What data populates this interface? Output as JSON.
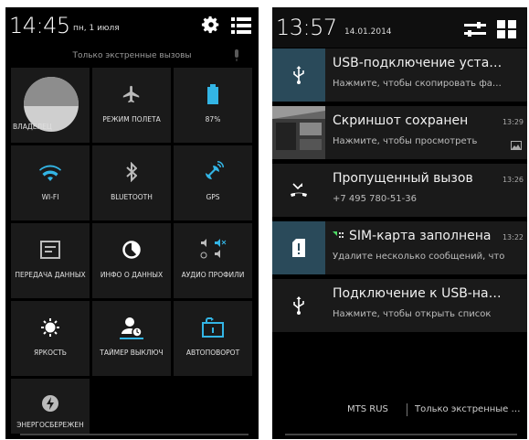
{
  "quick_settings": {
    "time": "14:45",
    "date": "пн, 1 июля",
    "emergency_text": "Только экстренные вызовы",
    "tiles": [
      {
        "label": "ВЛАДЕЛЕЦ",
        "icon": "avatar"
      },
      {
        "label": "РЕЖИМ ПОЛЕТА",
        "icon": "airplane-icon"
      },
      {
        "label": "87%",
        "icon": "battery-icon"
      },
      {
        "label": "WI-FI",
        "icon": "wifi-icon"
      },
      {
        "label": "BLUETOOTH",
        "icon": "bluetooth-icon"
      },
      {
        "label": "GPS",
        "icon": "gps-icon"
      },
      {
        "label": "ПЕРЕДАЧА ДАННЫХ",
        "icon": "data-transfer-icon"
      },
      {
        "label": "ИНФО О ДАННЫХ",
        "icon": "data-usage-icon"
      },
      {
        "label": "АУДИО ПРОФИЛИ",
        "icon": "audio-profiles-icon"
      },
      {
        "label": "ЯРКОСТЬ",
        "icon": "brightness-icon"
      },
      {
        "label": "ТАЙМЕР ВЫКЛЮЧ",
        "icon": "sleep-timer-icon"
      },
      {
        "label": "АВТОПОВОРОТ",
        "icon": "auto-rotate-icon"
      },
      {
        "label": "ЭНЕРГОСБЕРЕЖЕН",
        "icon": "power-saving-icon"
      }
    ]
  },
  "notifications_panel": {
    "time": "13:57",
    "date": "14.01.2014",
    "notifications": [
      {
        "title": "USB-подключение установлено",
        "text": "Нажмите, чтобы скопировать файлы",
        "time": "",
        "icon": "usb-icon"
      },
      {
        "title": "Скриншот сохранен",
        "text": "Нажмите, чтобы просмотреть",
        "time": "13:29",
        "icon": "screenshot-thumbnail"
      },
      {
        "title": "Пропущенный вызов",
        "text": "+7 495 780-51-36",
        "time": "13:26",
        "icon": "missed-call-icon"
      },
      {
        "title": "SIM-карта заполнена",
        "text": "Удалите несколько сообщений, что",
        "time": "13:22",
        "icon": "sim-card-icon"
      },
      {
        "title": "Подключение к USB-накопителю",
        "text": "Нажмите, чтобы открыть список",
        "time": "",
        "icon": "usb-icon"
      }
    ],
    "carrier": "MTS RUS",
    "emergency_text": "Только экстренные вызовы"
  },
  "colors": {
    "accent": "#33b5e5",
    "tile_bg": "#1a1a1a",
    "usb_icon_bg": "#2a4a5a"
  }
}
